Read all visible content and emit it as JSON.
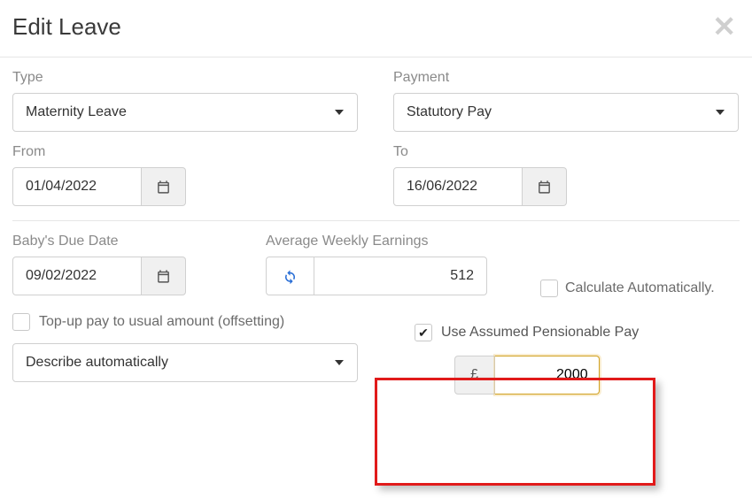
{
  "header": {
    "title": "Edit Leave"
  },
  "type": {
    "label": "Type",
    "value": "Maternity Leave"
  },
  "payment": {
    "label": "Payment",
    "value": "Statutory Pay"
  },
  "from": {
    "label": "From",
    "value": "01/04/2022"
  },
  "to": {
    "label": "To",
    "value": "16/06/2022"
  },
  "dueDate": {
    "label": "Baby's Due Date",
    "value": "09/02/2022"
  },
  "avgWeekly": {
    "label": "Average Weekly Earnings",
    "value": "512"
  },
  "calcAuto": {
    "label": "Calculate Automatically."
  },
  "topup": {
    "label": "Top-up pay to usual amount (offsetting)"
  },
  "describe": {
    "value": "Describe automatically"
  },
  "assumed": {
    "label": "Use Assumed Pensionable Pay",
    "currency": "£",
    "value": "2000"
  }
}
